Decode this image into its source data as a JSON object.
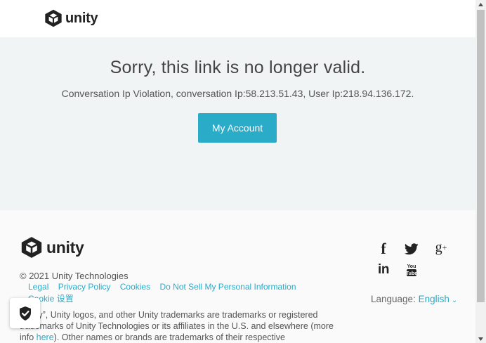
{
  "header": {
    "logo_text": "unity"
  },
  "hero": {
    "title": "Sorry, this link is no longer valid.",
    "message": "Conversation Ip Violation, conversation Ip:58.213.51.43, User Ip:218.94.136.172.",
    "button_label": "My Account"
  },
  "footer": {
    "logo_text": "unity",
    "copyright": "© 2021 Unity Technologies",
    "links": {
      "legal": "Legal",
      "privacy": "Privacy Policy",
      "cookies": "Cookies",
      "do_not_sell": "Do Not Sell My Personal Information"
    },
    "cookie_settings": "Cookie 设置",
    "legal_text_1": "“Unity”, Unity logos, and other Unity trademarks are trademarks or registered trademarks of Unity Technologies or its affiliates in the U.S. and elsewhere (more info ",
    "legal_link": "here",
    "legal_text_2": "). Other names or brands are trademarks of their respective",
    "language_label": "Language:",
    "language_value": "English",
    "social_icons": [
      "facebook-icon",
      "twitter-icon",
      "google-plus-icon",
      "linkedin-icon",
      "youtube-icon"
    ]
  },
  "colors": {
    "accent": "#2aabc8",
    "hero_bg": "#f0f4f5",
    "footer_bg": "#fafafa"
  }
}
